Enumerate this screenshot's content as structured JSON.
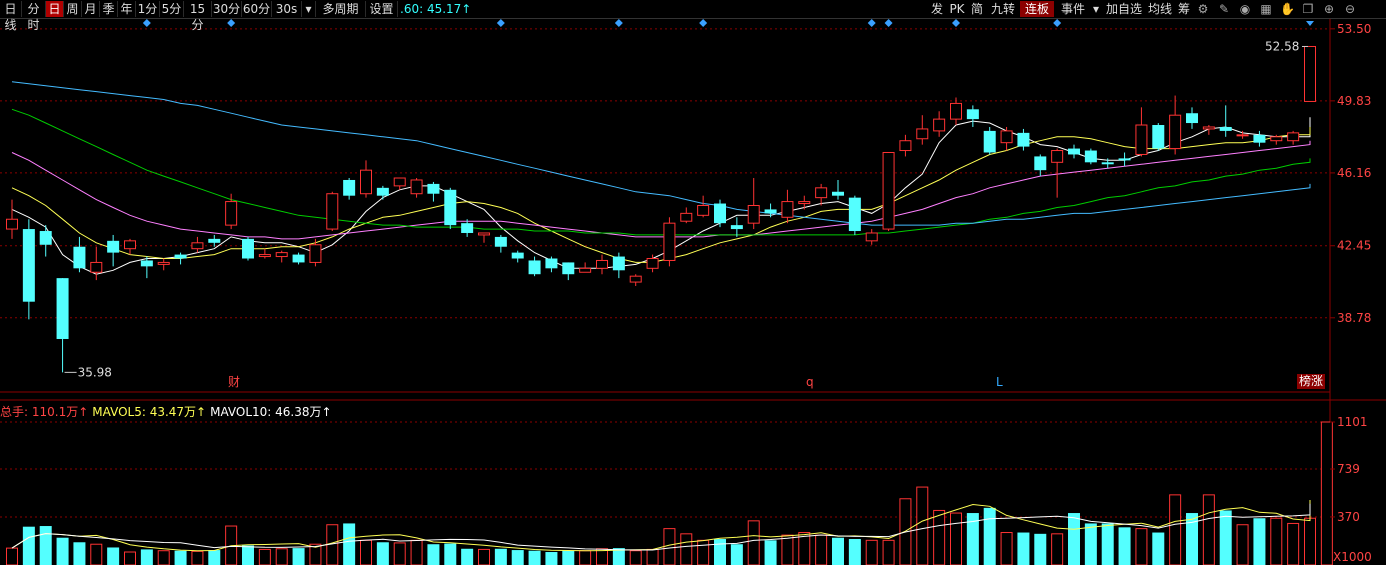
{
  "toolbar": {
    "left_buttons": [
      {
        "label": "日线"
      },
      {
        "label": "分时"
      },
      {
        "label": "日",
        "active": true
      },
      {
        "label": "周"
      },
      {
        "label": "月"
      },
      {
        "label": "季"
      },
      {
        "label": "年"
      },
      {
        "label": "1分"
      },
      {
        "label": "5分"
      },
      {
        "label": "15分"
      },
      {
        "label": "30分"
      },
      {
        "label": "60分"
      },
      {
        "label": "30s"
      },
      {
        "label": "多周期"
      },
      {
        "label": "设置"
      }
    ],
    "indicator_text": ".60: 45.17↑",
    "right_buttons": [
      {
        "label": "发"
      },
      {
        "label": "PK"
      },
      {
        "label": "简"
      },
      {
        "label": "九转"
      },
      {
        "label": "连板"
      },
      {
        "label": "事件"
      },
      {
        "label": "加自选"
      },
      {
        "label": "均线"
      },
      {
        "label": "筹"
      }
    ],
    "icons": [
      "settings-icon",
      "pen-icon",
      "eye-icon",
      "calendar-icon",
      "hand-icon",
      "copy-icon",
      "zoom-in-icon",
      "zoom-out-icon"
    ]
  },
  "price_panel": {
    "y_ticks": [
      "53.50",
      "49.83",
      "46.16",
      "42.45",
      "38.78"
    ],
    "high_label": "52.58",
    "low_label": "35.98",
    "markers": [
      "财",
      "q",
      "L"
    ],
    "badge": "榜涨",
    "colors": {
      "up": "#ff3333",
      "down": "#54ffff",
      "ma5": "#ffffff",
      "ma10": "#ffff55",
      "ma20": "#ff80ff",
      "ma60": "#00cc00",
      "ma120": "#44bbff",
      "grid": "#8b0000"
    }
  },
  "volume_panel": {
    "legend": [
      {
        "text": "总手: 110.1万↑",
        "color": "#ff4444"
      },
      {
        "text": "MAVOL5: 43.47万↑",
        "color": "#ffff55"
      },
      {
        "text": "MAVOL10: 46.38万↑",
        "color": "#ffffff"
      }
    ],
    "y_ticks": [
      "1101",
      "739",
      "370",
      "X1000"
    ]
  },
  "chart_data": {
    "type": "candlestick",
    "y_range": [
      35.0,
      54.0
    ],
    "candles": [
      [
        43.3,
        43.8,
        42.8,
        44.8
      ],
      [
        43.3,
        39.6,
        38.7,
        43.8
      ],
      [
        43.2,
        42.5,
        41.9,
        43.5
      ],
      [
        40.8,
        37.7,
        36.0,
        40.8
      ],
      [
        42.4,
        41.3,
        41.1,
        42.9
      ],
      [
        41.1,
        41.6,
        40.7,
        42.4
      ],
      [
        42.7,
        42.1,
        41.4,
        43.0
      ],
      [
        42.3,
        42.7,
        42.0,
        42.8
      ],
      [
        41.7,
        41.4,
        40.8,
        41.9
      ],
      [
        41.5,
        41.6,
        41.2,
        41.8
      ],
      [
        42.0,
        41.8,
        41.5,
        42.1
      ],
      [
        42.3,
        42.6,
        42.1,
        42.9
      ],
      [
        42.8,
        42.6,
        42.4,
        43.0
      ],
      [
        43.5,
        44.7,
        43.3,
        45.1
      ],
      [
        42.8,
        41.8,
        41.7,
        42.9
      ],
      [
        41.9,
        42.0,
        41.8,
        42.3
      ],
      [
        41.9,
        42.1,
        41.6,
        42.2
      ],
      [
        42.0,
        41.6,
        41.5,
        42.1
      ],
      [
        41.6,
        42.5,
        41.4,
        42.8
      ],
      [
        43.3,
        45.1,
        43.2,
        45.2
      ],
      [
        45.8,
        45.0,
        44.8,
        45.9
      ],
      [
        45.1,
        46.3,
        44.9,
        46.8
      ],
      [
        45.4,
        45.0,
        44.8,
        45.5
      ],
      [
        45.5,
        45.9,
        45.3,
        45.9
      ],
      [
        45.1,
        45.8,
        44.9,
        45.9
      ],
      [
        45.6,
        45.1,
        44.7,
        45.7
      ],
      [
        45.3,
        43.5,
        43.3,
        45.4
      ],
      [
        43.6,
        43.1,
        42.9,
        43.8
      ],
      [
        43.0,
        43.1,
        42.6,
        43.1
      ],
      [
        42.9,
        42.4,
        42.1,
        43.0
      ],
      [
        42.1,
        41.8,
        41.6,
        42.2
      ],
      [
        41.7,
        41.0,
        40.9,
        41.9
      ],
      [
        41.8,
        41.3,
        41.1,
        41.9
      ],
      [
        41.6,
        41.0,
        40.7,
        41.6
      ],
      [
        41.1,
        41.3,
        41.1,
        41.6
      ],
      [
        41.3,
        41.7,
        41.0,
        42.0
      ],
      [
        41.9,
        41.2,
        40.8,
        42.1
      ],
      [
        40.6,
        40.9,
        40.4,
        41.0
      ],
      [
        41.3,
        41.8,
        41.1,
        42.0
      ],
      [
        41.7,
        43.6,
        41.4,
        43.9
      ],
      [
        43.7,
        44.1,
        43.6,
        44.4
      ],
      [
        44.0,
        44.5,
        43.9,
        45.0
      ],
      [
        44.6,
        43.6,
        43.4,
        44.8
      ],
      [
        43.5,
        43.3,
        42.9,
        43.9
      ],
      [
        43.6,
        44.5,
        43.3,
        45.9
      ],
      [
        44.3,
        44.1,
        43.9,
        44.6
      ],
      [
        43.9,
        44.7,
        43.6,
        45.3
      ],
      [
        44.6,
        44.7,
        44.3,
        45.0
      ],
      [
        44.9,
        45.4,
        44.5,
        45.6
      ],
      [
        45.2,
        45.0,
        44.8,
        45.8
      ],
      [
        44.9,
        43.2,
        43.0,
        45.0
      ],
      [
        42.7,
        43.1,
        42.5,
        43.3
      ],
      [
        43.3,
        47.2,
        43.2,
        47.2
      ],
      [
        47.3,
        47.8,
        47.0,
        48.1
      ],
      [
        47.9,
        48.4,
        47.6,
        49.1
      ],
      [
        48.3,
        48.9,
        48.0,
        49.3
      ],
      [
        48.9,
        49.7,
        48.6,
        50.0
      ],
      [
        49.4,
        48.9,
        48.5,
        49.6
      ],
      [
        48.3,
        47.2,
        47.1,
        48.5
      ],
      [
        47.7,
        48.3,
        47.3,
        48.5
      ],
      [
        48.2,
        47.5,
        47.3,
        48.4
      ],
      [
        47.0,
        46.3,
        46.0,
        47.1
      ],
      [
        46.7,
        47.3,
        44.9,
        47.4
      ],
      [
        47.4,
        47.1,
        46.9,
        47.6
      ],
      [
        47.3,
        46.7,
        46.6,
        47.4
      ],
      [
        46.7,
        46.6,
        46.4,
        46.9
      ],
      [
        46.9,
        46.8,
        46.5,
        47.2
      ],
      [
        47.1,
        48.6,
        47.0,
        49.5
      ],
      [
        48.6,
        47.4,
        47.3,
        48.7
      ],
      [
        47.4,
        49.1,
        47.1,
        50.1
      ],
      [
        49.2,
        48.7,
        48.4,
        49.5
      ],
      [
        48.4,
        48.5,
        48.1,
        48.6
      ],
      [
        48.5,
        48.3,
        48.0,
        49.6
      ],
      [
        48.1,
        48.1,
        47.9,
        48.3
      ],
      [
        48.1,
        47.7,
        47.5,
        48.3
      ],
      [
        47.8,
        48.0,
        47.6,
        48.1
      ],
      [
        47.8,
        48.2,
        47.6,
        48.3
      ],
      [
        49.8,
        52.6,
        49.8,
        52.6
      ]
    ],
    "volumes": [
      130,
      295,
      300,
      210,
      175,
      160,
      135,
      100,
      120,
      110,
      110,
      105,
      115,
      300,
      150,
      120,
      125,
      130,
      160,
      310,
      320,
      190,
      175,
      170,
      190,
      160,
      165,
      125,
      120,
      125,
      115,
      110,
      100,
      110,
      110,
      125,
      130,
      110,
      120,
      280,
      240,
      190,
      200,
      160,
      340,
      190,
      230,
      250,
      230,
      210,
      200,
      190,
      190,
      510,
      600,
      420,
      400,
      400,
      440,
      250,
      250,
      240,
      240,
      400,
      320,
      320,
      290,
      280,
      250,
      540,
      400,
      540,
      420,
      310,
      360,
      360,
      320,
      360,
      1101
    ],
    "ma_series": [
      {
        "values": [
          44.3,
          43.9,
          43.4,
          42.0,
          41.4,
          41.0,
          41.2,
          41.6,
          41.8,
          41.8,
          41.9,
          42.1,
          42.3,
          42.9,
          42.7,
          42.6,
          42.6,
          42.4,
          42.1,
          42.5,
          43.2,
          44.2,
          44.9,
          45.3,
          45.5,
          45.5,
          45.1,
          44.7,
          44.3,
          43.4,
          42.7,
          42.1,
          41.7,
          41.3,
          41.3,
          41.3,
          41.4,
          41.5,
          41.8,
          42.2,
          42.7,
          43.2,
          43.6,
          44.0,
          44.0,
          44.0,
          44.2,
          44.4,
          44.6,
          44.7,
          44.4,
          44.1,
          44.6,
          45.4,
          46.1,
          47.7,
          48.6,
          48.8,
          48.7,
          48.3,
          48.0,
          47.6,
          47.5,
          47.2,
          46.9,
          46.8,
          46.8,
          47.1,
          47.3,
          47.7,
          48.0,
          48.4,
          48.5,
          48.2,
          48.1,
          48.0,
          48.0,
          48.0,
          49.0
        ],
        "color": "ma5"
      },
      {
        "values": [
          45.4,
          45.0,
          44.5,
          43.8,
          43.1,
          42.6,
          42.3,
          42.0,
          41.9,
          41.8,
          41.8,
          41.9,
          42.0,
          42.3,
          42.3,
          42.3,
          42.4,
          42.4,
          42.6,
          42.9,
          43.3,
          43.6,
          43.9,
          44.0,
          44.2,
          44.4,
          44.6,
          44.7,
          44.6,
          44.4,
          44.1,
          43.6,
          43.2,
          42.8,
          42.4,
          42.1,
          41.8,
          41.6,
          41.6,
          41.8,
          42.0,
          42.3,
          42.6,
          42.8,
          43.0,
          43.4,
          43.7,
          43.9,
          44.2,
          44.3,
          44.3,
          44.3,
          44.6,
          45.0,
          45.4,
          45.8,
          46.3,
          46.7,
          47.1,
          47.3,
          47.6,
          47.8,
          48.0,
          48.0,
          47.9,
          47.7,
          47.5,
          47.4,
          47.4,
          47.4,
          47.5,
          47.6,
          47.7,
          47.7,
          47.8,
          48.0,
          48.1,
          48.1,
          48.5
        ],
        "color": "ma10"
      },
      {
        "values": [
          47.2,
          46.8,
          46.3,
          45.8,
          45.3,
          44.8,
          44.4,
          44.0,
          43.7,
          43.5,
          43.3,
          43.2,
          43.1,
          43.0,
          42.9,
          42.9,
          42.8,
          42.8,
          42.9,
          43.0,
          43.1,
          43.2,
          43.3,
          43.4,
          43.5,
          43.6,
          43.7,
          43.7,
          43.7,
          43.7,
          43.6,
          43.5,
          43.4,
          43.3,
          43.2,
          43.1,
          43.0,
          42.9,
          42.9,
          42.9,
          42.9,
          42.9,
          43.0,
          43.0,
          43.0,
          43.1,
          43.2,
          43.3,
          43.4,
          43.5,
          43.6,
          43.7,
          43.9,
          44.1,
          44.3,
          44.6,
          44.9,
          45.1,
          45.4,
          45.6,
          45.8,
          46.0,
          46.1,
          46.2,
          46.3,
          46.4,
          46.5,
          46.6,
          46.7,
          46.8,
          46.9,
          47.0,
          47.1,
          47.2,
          47.3,
          47.4,
          47.5,
          47.6,
          47.8
        ],
        "color": "ma20"
      },
      {
        "values": [
          49.4,
          49.1,
          48.7,
          48.3,
          47.9,
          47.5,
          47.1,
          46.7,
          46.3,
          46.0,
          45.7,
          45.4,
          45.1,
          44.8,
          44.6,
          44.4,
          44.2,
          44.0,
          43.9,
          43.8,
          43.7,
          43.6,
          43.5,
          43.5,
          43.4,
          43.4,
          43.4,
          43.4,
          43.3,
          43.3,
          43.3,
          43.2,
          43.2,
          43.2,
          43.1,
          43.1,
          43.1,
          43.0,
          43.0,
          43.0,
          43.0,
          43.0,
          43.0,
          43.0,
          43.0,
          43.0,
          43.0,
          43.0,
          43.0,
          43.0,
          43.0,
          43.1,
          43.1,
          43.2,
          43.3,
          43.4,
          43.5,
          43.6,
          43.8,
          43.9,
          44.1,
          44.2,
          44.4,
          44.5,
          44.7,
          44.9,
          45.0,
          45.2,
          45.4,
          45.5,
          45.7,
          45.8,
          46.0,
          46.1,
          46.3,
          46.4,
          46.6,
          46.7,
          46.9
        ],
        "color": "ma60"
      },
      {
        "values": [
          50.8,
          50.7,
          50.6,
          50.5,
          50.4,
          50.3,
          50.2,
          50.1,
          50.0,
          49.9,
          49.7,
          49.6,
          49.4,
          49.2,
          49.0,
          48.8,
          48.6,
          48.5,
          48.4,
          48.3,
          48.2,
          48.1,
          48.0,
          47.9,
          47.8,
          47.6,
          47.4,
          47.2,
          47.0,
          46.8,
          46.6,
          46.4,
          46.2,
          46.0,
          45.8,
          45.6,
          45.4,
          45.2,
          45.1,
          45.0,
          44.8,
          44.6,
          44.5,
          44.3,
          44.2,
          44.1,
          44.0,
          43.9,
          43.8,
          43.7,
          43.6,
          43.5,
          43.5,
          43.5,
          43.5,
          43.5,
          43.6,
          43.6,
          43.7,
          43.8,
          43.8,
          43.9,
          44.0,
          44.1,
          44.1,
          44.2,
          44.3,
          44.4,
          44.5,
          44.6,
          44.7,
          44.8,
          44.9,
          45.0,
          45.1,
          45.2,
          45.3,
          45.4,
          45.6
        ],
        "color": "ma120"
      }
    ]
  }
}
